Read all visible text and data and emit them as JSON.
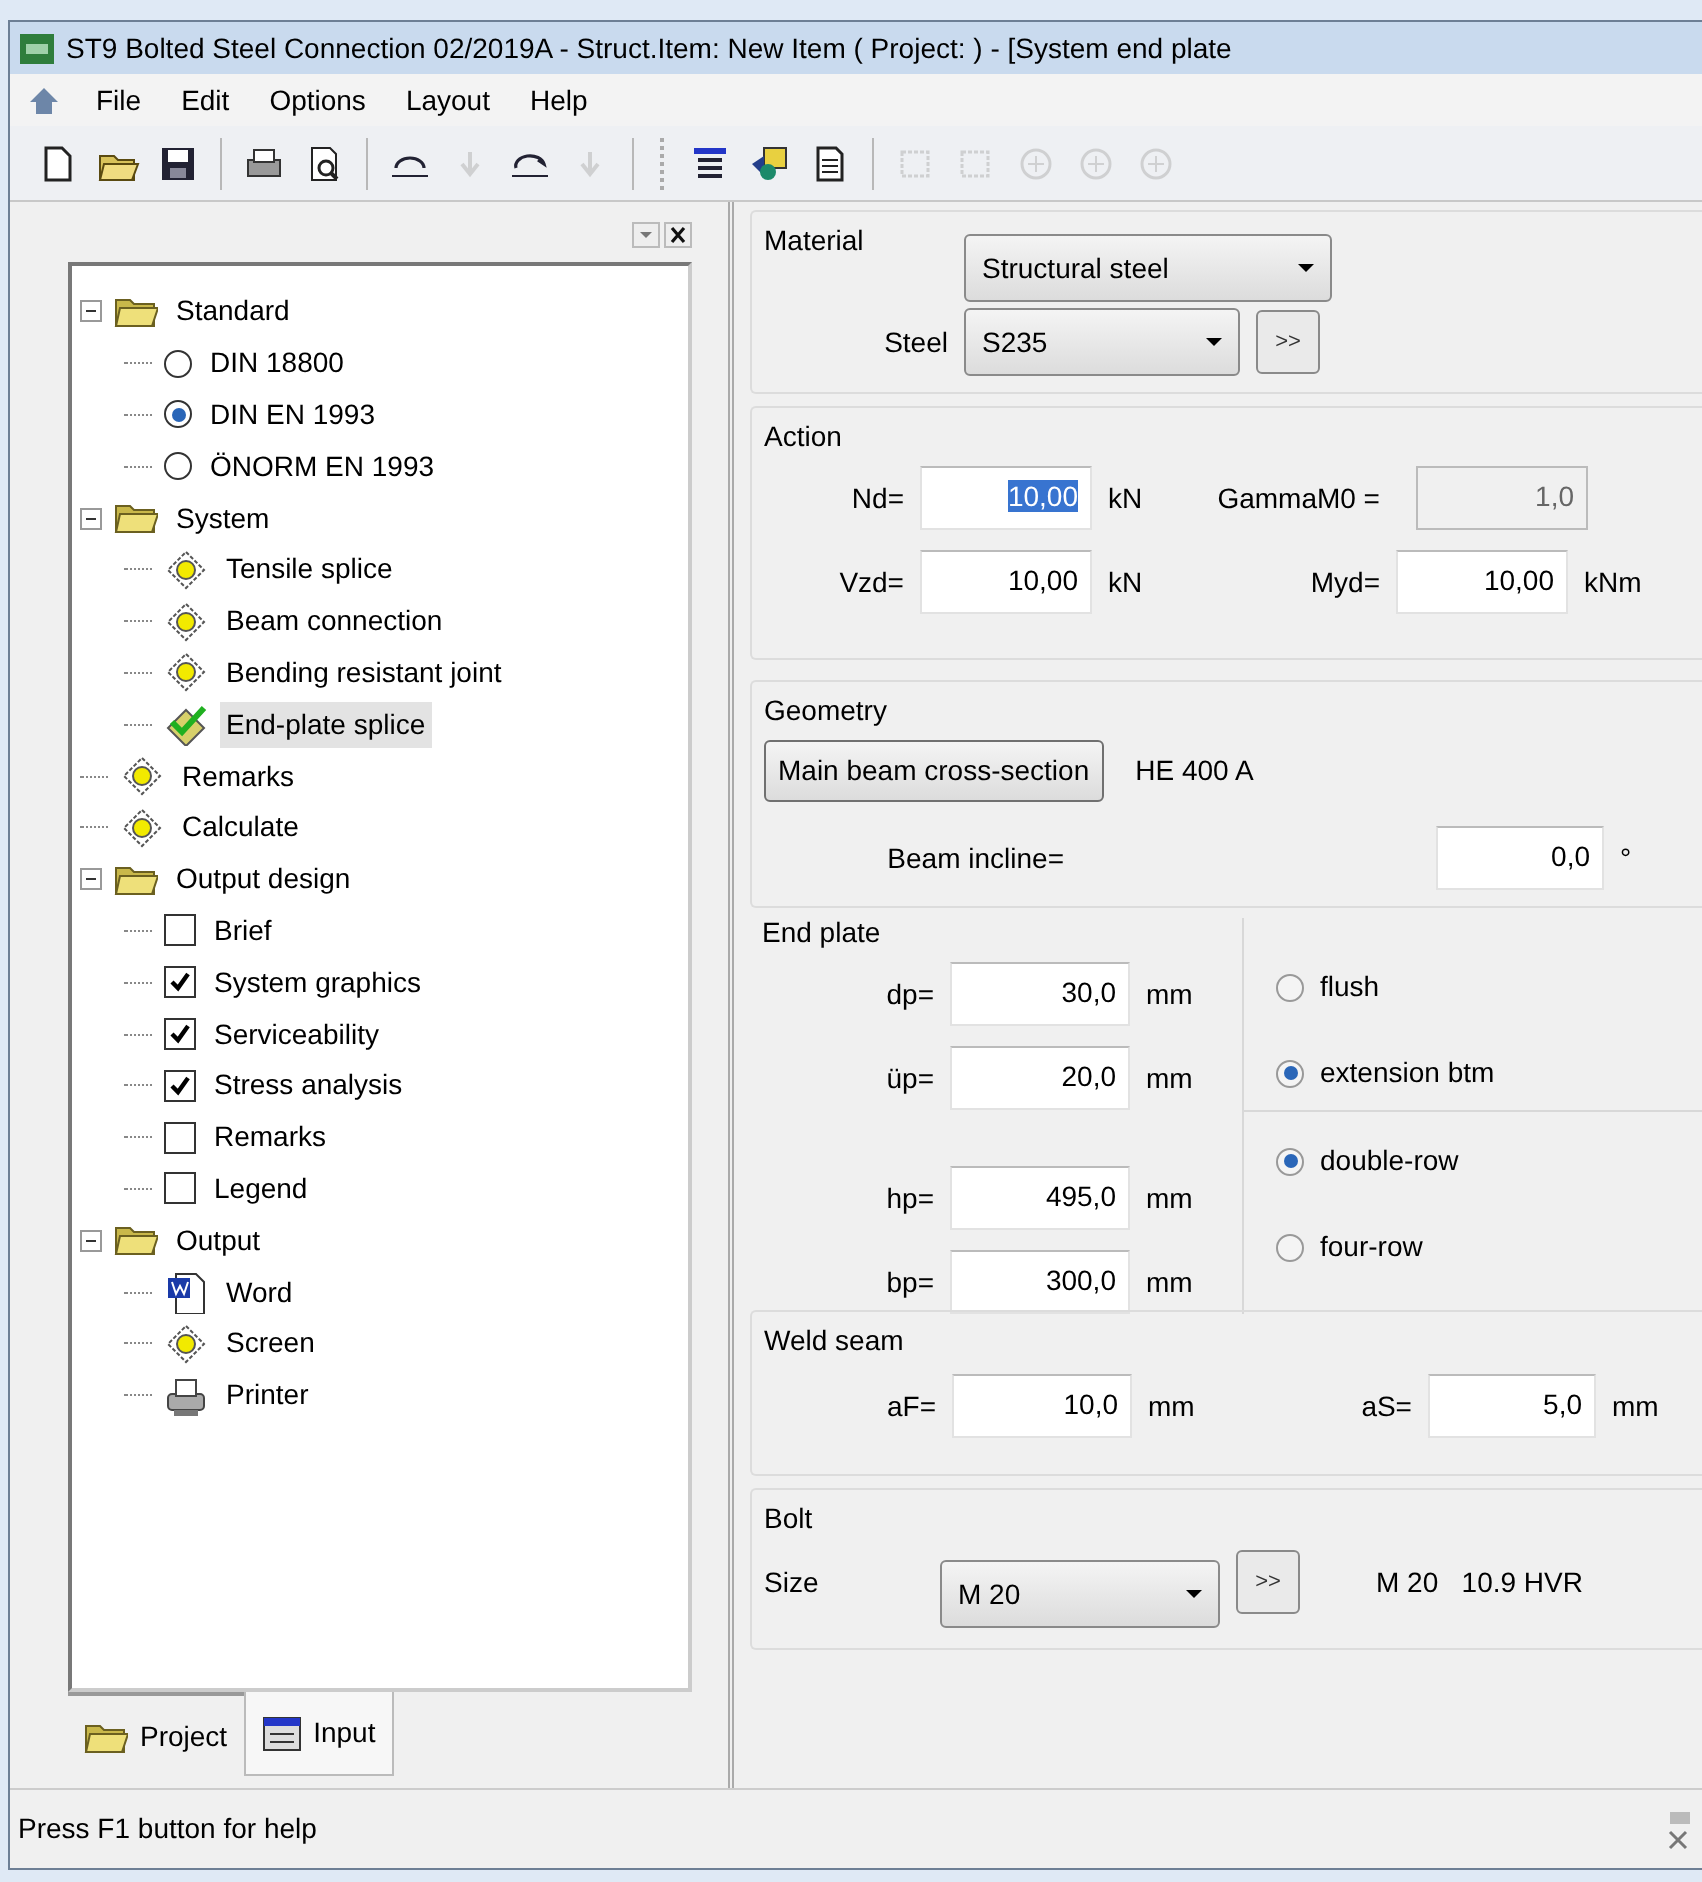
{
  "window": {
    "title": "ST9 Bolted Steel Connection 02/2019A - Struct.Item: New Item ( Project: ) - [System end plate"
  },
  "menu": [
    "File",
    "Edit",
    "Options",
    "Layout",
    "Help"
  ],
  "toolbar": [
    {
      "kind": "new",
      "disabled": false
    },
    {
      "kind": "open",
      "disabled": false
    },
    {
      "kind": "save",
      "disabled": false
    },
    {
      "kind": "sep"
    },
    {
      "kind": "printsetup",
      "disabled": false
    },
    {
      "kind": "preview",
      "disabled": false
    },
    {
      "kind": "sep"
    },
    {
      "kind": "undo",
      "disabled": false
    },
    {
      "kind": "down",
      "disabled": true
    },
    {
      "kind": "redo",
      "disabled": false
    },
    {
      "kind": "down",
      "disabled": true
    },
    {
      "kind": "sep"
    },
    {
      "kind": "grip"
    },
    {
      "kind": "list",
      "disabled": false
    },
    {
      "kind": "shapes",
      "disabled": false
    },
    {
      "kind": "doc",
      "disabled": false
    },
    {
      "kind": "sep"
    },
    {
      "kind": "frame",
      "disabled": true
    },
    {
      "kind": "frame",
      "disabled": true
    },
    {
      "kind": "circle",
      "disabled": true
    },
    {
      "kind": "circle",
      "disabled": true
    },
    {
      "kind": "circle",
      "disabled": true
    }
  ],
  "tree": [
    {
      "label": "Standard",
      "kind": "folder",
      "expanded": true,
      "selected": false,
      "children": [
        {
          "label": "DIN 18800",
          "kind": "radio",
          "checked": false,
          "selected": false
        },
        {
          "label": "DIN EN 1993",
          "kind": "radio",
          "checked": true,
          "selected": false
        },
        {
          "label": "ÖNORM EN 1993",
          "kind": "radio",
          "checked": false,
          "selected": false
        }
      ]
    },
    {
      "label": "System",
      "kind": "folder",
      "expanded": true,
      "selected": false,
      "children": [
        {
          "label": "Tensile splice",
          "kind": "item",
          "selected": false
        },
        {
          "label": "Beam connection",
          "kind": "item",
          "selected": false
        },
        {
          "label": "Bending resistant joint",
          "kind": "item",
          "selected": false
        },
        {
          "label": "End-plate splice",
          "kind": "done",
          "selected": true
        }
      ]
    },
    {
      "label": "Remarks",
      "kind": "item",
      "selected": false
    },
    {
      "label": "Calculate",
      "kind": "item",
      "selected": false
    },
    {
      "label": "Output design",
      "kind": "folder",
      "expanded": true,
      "selected": false,
      "children": [
        {
          "label": "Brief",
          "kind": "check",
          "checked": false,
          "selected": false
        },
        {
          "label": "System graphics",
          "kind": "check",
          "checked": true,
          "selected": false
        },
        {
          "label": "Serviceability",
          "kind": "check",
          "checked": true,
          "selected": false
        },
        {
          "label": "Stress analysis",
          "kind": "check",
          "checked": true,
          "selected": false
        },
        {
          "label": "Remarks",
          "kind": "check",
          "checked": false,
          "selected": false
        },
        {
          "label": "Legend",
          "kind": "check",
          "checked": false,
          "selected": false
        }
      ]
    },
    {
      "label": "Output",
      "kind": "folder",
      "expanded": true,
      "selected": false,
      "children": [
        {
          "label": "Word",
          "kind": "word",
          "selected": false
        },
        {
          "label": "Screen",
          "kind": "item",
          "selected": false
        },
        {
          "label": "Printer",
          "kind": "printer",
          "selected": false
        }
      ]
    }
  ],
  "panel_tabs": [
    {
      "label": "Project",
      "kind": "folder",
      "selected": false
    },
    {
      "label": "Input",
      "kind": "form",
      "selected": true
    }
  ],
  "material": {
    "title": "Material",
    "type": "Structural steel",
    "steel_label": "Steel",
    "steel": "S235",
    "more": ">>"
  },
  "action": {
    "title": "Action",
    "rows": [
      [
        {
          "label": "Nd=",
          "value": "10,00",
          "unit": "kN",
          "focused": true,
          "disabled": false
        },
        {
          "label": "GammaM0 =",
          "value": "1,0",
          "disabled": true,
          "focused": false
        }
      ],
      [
        {
          "label": "Vzd=",
          "value": "10,00",
          "unit": "kN",
          "focused": false,
          "disabled": false
        },
        {
          "label": "Myd=",
          "value": "10,00",
          "unit": "kNm",
          "focused": false,
          "disabled": false
        }
      ]
    ]
  },
  "geometry": {
    "title": "Geometry",
    "button": "Main beam cross-section",
    "section": "HE 400 A",
    "incline_label": "Beam incline=",
    "incline": "0,0",
    "incline_unit": "°"
  },
  "end_plate": {
    "title": "End plate",
    "fields": [
      {
        "label": "dp=",
        "value": "30,0",
        "unit": "mm"
      },
      {
        "label": "üp=",
        "value": "20,0",
        "unit": "mm"
      },
      {
        "label": "hp=",
        "value": "495,0",
        "unit": "mm"
      },
      {
        "label": "bp=",
        "value": "300,0",
        "unit": "mm"
      }
    ],
    "radio_groups": [
      [
        {
          "label": "flush",
          "selected": false
        },
        {
          "label": "extension btm",
          "selected": true
        }
      ],
      [
        {
          "label": "double-row",
          "selected": true
        },
        {
          "label": "four-row",
          "selected": false
        }
      ]
    ]
  },
  "weld_seam": {
    "title": "Weld seam",
    "fields": [
      {
        "label": "aF=",
        "value": "10,0",
        "unit": "mm"
      },
      {
        "label": "aS=",
        "value": "5,0",
        "unit": "mm"
      }
    ]
  },
  "bolt": {
    "title": "Bolt",
    "size_label": "Size",
    "size": "M 20",
    "more": ">>",
    "description": "M 20   10.9 HVR"
  },
  "status_bar": {
    "text": "Press F1 button for help"
  }
}
